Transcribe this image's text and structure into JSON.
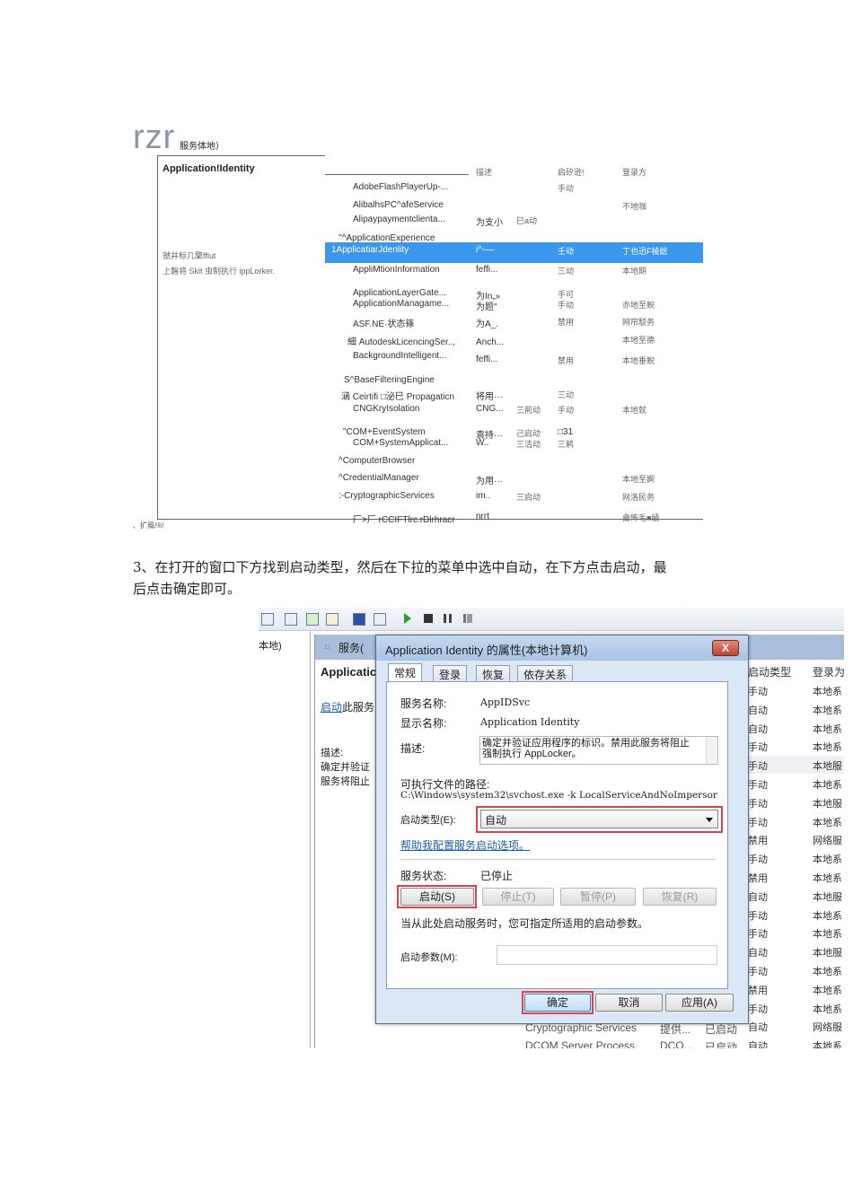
{
  "doc1": {
    "title_big": "rzr",
    "title_small": "服务体地）",
    "left_title": "Application!Identity",
    "left_line1": "虢井标几檠fflut",
    "left_line2": "上磐将 Skit 虫制执行 ippLorker.",
    "headers": {
      "desc": "描述",
      "startup": "启矽逊!",
      "logon": "登录方"
    },
    "rows": [
      {
        "name": "AdobeFlashPlayerUp-...",
        "desc": "",
        "status": "",
        "startup": "手动",
        "logon": ""
      },
      {
        "name": "AlibalhsPC^afeService",
        "desc": "",
        "status": "",
        "startup": "",
        "logon": "不地咖"
      },
      {
        "name": "Alipaypaymentclienta...",
        "desc": "为支小",
        "status": "巳a动",
        "startup": "",
        "logon": ""
      },
      {
        "name": "''^ApplicationExperience",
        "desc": "",
        "status": "",
        "startup": "",
        "logon": ""
      },
      {
        "name": "1ApplicatiarJdenlity",
        "desc": "i^-—",
        "status": "",
        "startup": "壬动",
        "logon": "丁也迅F棱総",
        "selected": true
      },
      {
        "name": "AppliMtionInformation",
        "desc": "feffi...",
        "status": "",
        "startup": "三动",
        "logon": "本地期"
      },
      {
        "name": "ApplicationLayerGate...",
        "desc": "为In„»",
        "status": "",
        "startup": "手可",
        "logon": ""
      },
      {
        "name": "ApplicationManagame...",
        "desc": "为题\"",
        "status": "",
        "startup": "手动",
        "logon": "亦地至鲵"
      },
      {
        "name": "ASF.NE·状态篠",
        "desc": "为A_.",
        "status": "",
        "startup": "禁用",
        "logon": "网帘駁务"
      },
      {
        "name": "細 AutodeskLicencingSer..,",
        "desc": "Anch...",
        "status": "",
        "startup": "",
        "logon": "本地至德"
      },
      {
        "name": "BackgroundIntelligent...",
        "desc": "feffi...",
        "status": "",
        "startup": "禁用",
        "logon": "本地垂鲵"
      },
      {
        "name": "S^BaseFilteringEngine",
        "desc": "",
        "status": "",
        "startup": "",
        "logon": ""
      },
      {
        "name": "涵 Ceirtifi □泌巳 Propagaticn",
        "desc": "将用···",
        "status": "",
        "startup": "三动",
        "logon": ""
      },
      {
        "name": "CNGKryIsolation",
        "desc": "CNG...",
        "status": "三荊动",
        "startup": "手动",
        "logon": "本地就"
      },
      {
        "name": "\"COM+EventSystem",
        "desc": "袁持···",
        "status": "己启动",
        "startup": "□31",
        "logon": ""
      },
      {
        "name": "COM+SystemApplicat...",
        "desc": "W..",
        "status": "三洁动",
        "startup": "三鹡",
        "logon": ""
      },
      {
        "name": "^ComputerBrowser",
        "desc": "",
        "status": "",
        "startup": "",
        "logon": ""
      },
      {
        "name": "^CredentialManager",
        "desc": "为用···",
        "status": "",
        "startup": "",
        "logon": "本地至婀"
      },
      {
        "name": ":-CryptographicServices",
        "desc": "im..",
        "status": "三启动",
        "startup": "",
        "logon": "网洛民务"
      },
      {
        "name": "厂>厂 rCCIFTlrc.rDlrhracr",
        "desc": "nrrt",
        "status": "",
        "startup": "",
        "logon": "龠怖毛■績"
      }
    ],
    "caption": "、扩風/®/"
  },
  "step3": {
    "line1": "3、在打开的窗口下方找到启动类型，然后在下拉的菜单中选中自动，在下方点击启动，最",
    "line2": "后点击确定即可。"
  },
  "shot2": {
    "tree_label": "本地)",
    "panel_title": "服务(",
    "panel_name": "Applicatic",
    "start_link": "启动",
    "start_suffix": "此服务",
    "desc_label": "描述:",
    "desc_l1": "确定并验证",
    "desc_l2": "服务将阻止",
    "list_headers": {
      "startup": "启动类型",
      "logon": "登录为"
    },
    "list_rows": [
      [
        "手动",
        "本地系"
      ],
      [
        "自动",
        "本地系"
      ],
      [
        "自动",
        "本地系"
      ],
      [
        "手动",
        "本地系"
      ],
      [
        "手动",
        "本地服"
      ],
      [
        "手动",
        "本地系"
      ],
      [
        "手动",
        "本地服"
      ],
      [
        "手动",
        "本地系"
      ],
      [
        "禁用",
        "网络服"
      ],
      [
        "手动",
        "本地系"
      ],
      [
        "禁用",
        "本地系"
      ],
      [
        "自动",
        "本地服"
      ],
      [
        "手动",
        "本地系"
      ],
      [
        "手动",
        "本地系"
      ],
      [
        "自动",
        "本地服"
      ],
      [
        "手动",
        "本地系"
      ],
      [
        "禁用",
        "本地系"
      ],
      [
        "手动",
        "本地系"
      ],
      [
        "自动",
        "网络服"
      ],
      [
        "自动",
        "本地系"
      ]
    ],
    "bottom_rows": [
      {
        "name": "Cryptographic Services",
        "desc": "提供...",
        "status": "已启动"
      },
      {
        "name": "DCOM Server Process",
        "desc": "DCO...",
        "status": "已启动"
      }
    ],
    "dialog": {
      "title": "Application Identity 的属性(本地计算机)",
      "close": "X",
      "tabs": [
        "常规",
        "登录",
        "恢复",
        "依存关系"
      ],
      "service_name_label": "服务名称:",
      "service_name": "AppIDSvc",
      "display_name_label": "显示名称:",
      "display_name": "Application Identity",
      "desc_label": "描述:",
      "desc": "确定并验证应用程序的标识。禁用此服务将阻止强制执行 AppLocker。",
      "path_label": "可执行文件的路径:",
      "path": "C:\\Windows\\system32\\svchost.exe -k LocalServiceAndNoImpersor",
      "startup_label": "启动类型(E):",
      "startup_value": "自动",
      "help_link": "帮助我配置服务启动选项。",
      "status_label": "服务状态:",
      "status_value": "已停止",
      "btn_start": "启动(S)",
      "btn_stop": "停止(T)",
      "btn_pause": "暂停(P)",
      "btn_resume": "恢复(R)",
      "hint": "当从此处启动服务时，您可指定所适用的启动参数。",
      "params_label": "启动参数(M):",
      "params_value": "",
      "ok": "确定",
      "cancel": "取消",
      "apply": "应用(A)"
    }
  },
  "colors": {
    "selection": "#3a97ee",
    "highlight": "#e04050",
    "link": "#1a5fb4"
  }
}
